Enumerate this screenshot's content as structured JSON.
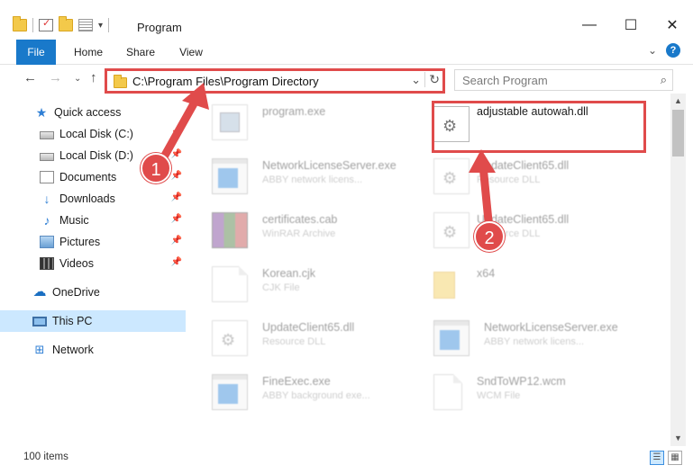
{
  "window": {
    "title": "Program",
    "minimize": "—",
    "maximize": "☐",
    "close": "✕"
  },
  "ribbon": {
    "tabs": [
      "File",
      "Home",
      "Share",
      "View"
    ],
    "expand": "⌄",
    "help": "?"
  },
  "address": {
    "path": "C:\\Program Files\\Program Directory",
    "dropdown": "⌄",
    "refresh": "↻"
  },
  "search": {
    "placeholder": "Search Program",
    "icon": "search-icon"
  },
  "nav_buttons": {
    "back": "←",
    "forward": "→",
    "recent": "⌄",
    "up": "↑"
  },
  "sidebar": {
    "items": [
      {
        "label": "Quick access",
        "icon": "star-icon",
        "pinned": false
      },
      {
        "label": "Local Disk (C:)",
        "icon": "disk-icon",
        "pinned": true
      },
      {
        "label": "Local Disk (D:)",
        "icon": "disk-icon",
        "pinned": true
      },
      {
        "label": "Documents",
        "icon": "documents-icon",
        "pinned": true
      },
      {
        "label": "Downloads",
        "icon": "downloads-icon",
        "pinned": true
      },
      {
        "label": "Music",
        "icon": "music-icon",
        "pinned": true
      },
      {
        "label": "Pictures",
        "icon": "pictures-icon",
        "pinned": true
      },
      {
        "label": "Videos",
        "icon": "videos-icon",
        "pinned": true
      },
      {
        "label": "OneDrive",
        "icon": "onedrive-icon",
        "pinned": false
      },
      {
        "label": "This PC",
        "icon": "this-pc-icon",
        "pinned": false,
        "selected": true
      },
      {
        "label": "Network",
        "icon": "network-icon",
        "pinned": false
      }
    ]
  },
  "files": [
    {
      "name": "program.exe",
      "type": "",
      "icon": "setup-icon"
    },
    {
      "name": "adjustable autowah.dll",
      "type": "",
      "icon": "dll-gear-icon",
      "highlighted": true
    },
    {
      "name": "NetworkLicenseServer.exe",
      "type": "ABBY network licens...",
      "icon": "exe-icon"
    },
    {
      "name": "UpdateClient65.dll",
      "type": "Resource DLL",
      "icon": "dll-gear-icon"
    },
    {
      "name": "certificates.cab",
      "type": "WinRAR Archive",
      "icon": "winrar-icon"
    },
    {
      "name": "UpdateClient65.dll",
      "type": "Resource DLL",
      "icon": "dll-gear-icon"
    },
    {
      "name": "Korean.cjk",
      "type": "CJK File",
      "icon": "file-icon"
    },
    {
      "name": "x64",
      "type": "",
      "icon": "folder-icon"
    },
    {
      "name": "UpdateClient65.dll",
      "type": "Resource DLL",
      "icon": "dll-gear-icon"
    },
    {
      "name": "NetworkLicenseServer.exe",
      "type": "ABBY network licens...",
      "icon": "exe-icon"
    },
    {
      "name": "FineExec.exe",
      "type": "ABBY background exe...",
      "icon": "exe-icon"
    },
    {
      "name": "SndToWP12.wcm",
      "type": "WCM File",
      "icon": "file-icon"
    }
  ],
  "callouts": [
    {
      "number": "1"
    },
    {
      "number": "2"
    }
  ],
  "status": {
    "item_count": "100 items"
  },
  "scroll": {
    "up": "▲",
    "down": "▼"
  },
  "colors": {
    "accent": "#1979ca",
    "highlight_red": "#e04b4b",
    "selection": "#cce8ff"
  }
}
